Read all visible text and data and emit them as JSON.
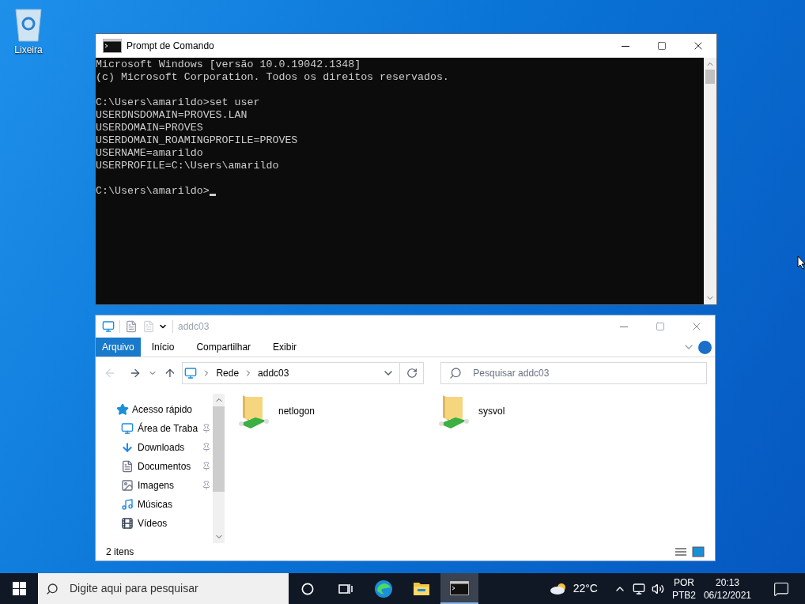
{
  "desktop_icons": [
    {
      "label": "Lixeira"
    }
  ],
  "cmd_window": {
    "title": "Prompt de Comando",
    "blocks": [
      [
        "Microsoft Windows [versão 10.0.19042.1348]",
        "(c) Microsoft Corporation. Todos os direitos reservados."
      ],
      [
        "C:\\Users\\amarildo>set user",
        "USERDNSDOMAIN=PROVES.LAN",
        "USERDOMAIN=PROVES",
        "USERDOMAIN_ROAMINGPROFILE=PROVES",
        "USERNAME=amarildo",
        "USERPROFILE=C:\\Users\\amarildo"
      ],
      [
        "C:\\Users\\amarildo>"
      ]
    ],
    "cursor": true
  },
  "explorer": {
    "title": "addc03",
    "ribbon_tabs": [
      {
        "label": "Arquivo",
        "selected": true
      },
      {
        "label": "Início",
        "selected": false
      },
      {
        "label": "Compartilhar",
        "selected": false
      },
      {
        "label": "Exibir",
        "selected": false
      }
    ],
    "breadcrumb": [
      "Rede",
      "addc03"
    ],
    "search": {
      "placeholder": "Pesquisar addc03"
    },
    "nav": {
      "label": "Acesso rápido",
      "children": [
        {
          "label": "Área de Traba",
          "kind": "desktop",
          "pinned": true
        },
        {
          "label": "Downloads",
          "kind": "downloads",
          "pinned": true
        },
        {
          "label": "Documentos",
          "kind": "documents",
          "pinned": true
        },
        {
          "label": "Imagens",
          "kind": "pictures",
          "pinned": true
        },
        {
          "label": "Músicas",
          "kind": "music",
          "pinned": false
        },
        {
          "label": "Vídeos",
          "kind": "videos",
          "pinned": false
        }
      ]
    },
    "items": [
      {
        "name": "netlogon"
      },
      {
        "name": "sysvol"
      }
    ],
    "status": "2 itens"
  },
  "taskbar": {
    "search_placeholder": "Digite aqui para pesquisar",
    "apps": [
      {
        "kind": "cortana",
        "selected": false
      },
      {
        "kind": "taskview",
        "selected": false
      },
      {
        "kind": "edge",
        "selected": false
      },
      {
        "kind": "explorer",
        "selected": false
      },
      {
        "kind": "cmd",
        "selected": true
      }
    ],
    "temperature": "22°C",
    "language": "POR",
    "layout": "PTB2",
    "time": "20:13",
    "date": "06/12/2021"
  }
}
